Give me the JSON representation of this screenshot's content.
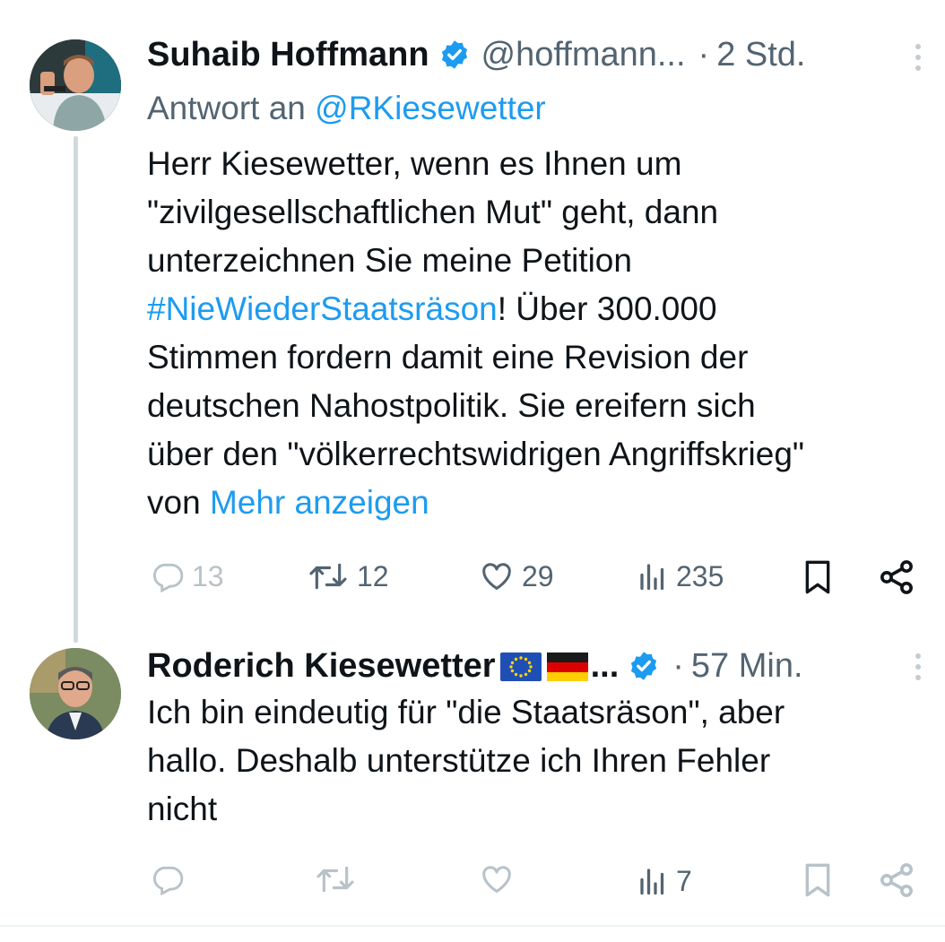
{
  "tweet1": {
    "author_name": "Suhaib Hoffmann",
    "handle": "@hoffmann...",
    "time": "2 Std.",
    "reply_prefix": "Antwort an",
    "reply_handle": "@RKiesewetter",
    "lines": [
      "Herr Kiesewetter, wenn es Ihnen um",
      "\"zivilgesellschaftlichen Mut\" geht, dann",
      "unterzeichnen Sie meine Petition"
    ],
    "hashtag": "#NieWiederStaatsräson",
    "line4_rest": "! Über 300.000",
    "lines_after": [
      "Stimmen fordern damit eine Revision der",
      "deutschen Nahostpolitik. Sie ereifern sich",
      "über den \"völkerrechtswidrigen Angriffskrieg\""
    ],
    "last_prefix": "von ",
    "show_more": "Mehr anzeigen",
    "stats": {
      "replies": "13",
      "retweets": "12",
      "likes": "29",
      "views": "235"
    }
  },
  "tweet2": {
    "author_name": "Roderich Kiesewetter",
    "name_ellipsis": "...",
    "time": "57 Min.",
    "lines": [
      "Ich bin eindeutig für \"die Staatsräson\", aber",
      "hallo. Deshalb unterstütze ich Ihren Fehler",
      "nicht"
    ],
    "stats": {
      "views": "7"
    }
  },
  "separator": "·",
  "colors": {
    "accent": "#1d9bf0",
    "muted": "#536471",
    "thread_line": "#cfd9de",
    "verified": "#1d9bf0"
  },
  "icons": [
    "verified-badge-icon",
    "more-options-icon",
    "reply-icon",
    "retweet-icon",
    "like-icon",
    "views-icon",
    "bookmark-icon",
    "share-icon",
    "eu-flag-icon",
    "germany-flag-icon"
  ]
}
